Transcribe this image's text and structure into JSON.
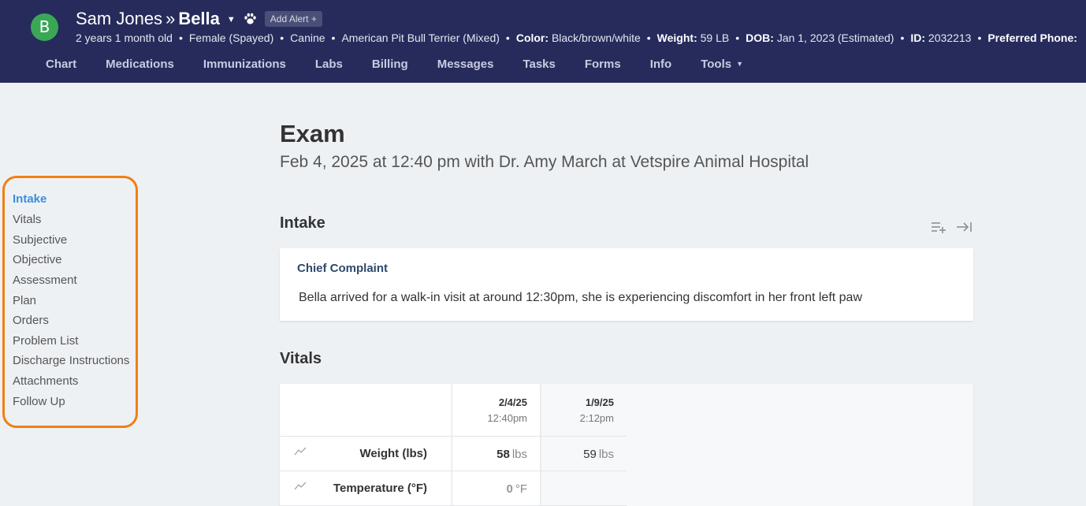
{
  "patient": {
    "avatar_letter": "B",
    "owner": "Sam Jones",
    "separator": "»",
    "pet_name": "Bella",
    "add_alert": "Add Alert +",
    "info": {
      "age": "2 years 1 month old",
      "sex": "Female (Spayed)",
      "species": "Canine",
      "breed": "American Pit Bull Terrier (Mixed)",
      "color_label": "Color:",
      "color": "Black/brown/white",
      "weight_label": "Weight:",
      "weight": "59 LB",
      "dob_label": "DOB:",
      "dob": "Jan 1, 2023 (Estimated)",
      "id_label": "ID:",
      "id": "2032213",
      "phone_label": "Preferred Phone:"
    }
  },
  "nav": {
    "tabs": [
      "Chart",
      "Medications",
      "Immunizations",
      "Labs",
      "Billing",
      "Messages",
      "Tasks",
      "Forms",
      "Info",
      "Tools"
    ]
  },
  "sidebar": {
    "items": [
      "Intake",
      "Vitals",
      "Subjective",
      "Objective",
      "Assessment",
      "Plan",
      "Orders",
      "Problem List",
      "Discharge Instructions",
      "Attachments",
      "Follow Up"
    ],
    "active": "Intake",
    "highlight_color": "#f07f14"
  },
  "exam": {
    "title": "Exam",
    "subtitle": "Feb 4, 2025 at 12:40 pm with Dr. Amy March at Vetspire Animal Hospital"
  },
  "intake": {
    "heading": "Intake",
    "chief_complaint_label": "Chief Complaint",
    "chief_complaint_text": "Bella arrived for a walk-in visit at around 12:30pm, she is experiencing discomfort in her front left paw"
  },
  "vitals": {
    "heading": "Vitals",
    "columns": [
      {
        "date": "2/4/25",
        "time": "12:40pm"
      },
      {
        "date": "1/9/25",
        "time": "2:12pm"
      }
    ],
    "rows": [
      {
        "label": "Weight (lbs)",
        "current": "58",
        "current_unit": "lbs",
        "previous": "59",
        "previous_unit": "lbs"
      },
      {
        "label": "Temperature (°F)",
        "current": "0",
        "current_unit": "°F",
        "previous": "",
        "previous_unit": ""
      }
    ]
  },
  "colors": {
    "header_bg": "#262b5c",
    "avatar": "#3aa757",
    "active_link": "#3b8dde"
  }
}
